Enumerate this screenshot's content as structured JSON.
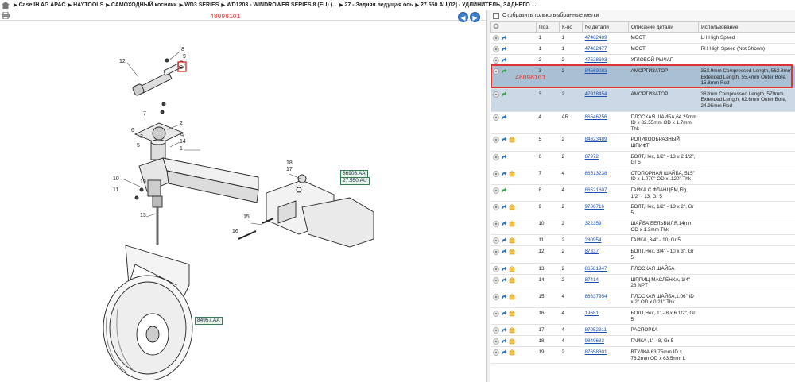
{
  "breadcrumb": [
    "Case IH AG APAC",
    "HAYTOOLS",
    "САМОХОДНЫЙ косилки",
    "WD3 SERIES",
    "WD1203 - WINDROWER SERIES 8 (EU) (...",
    "27 - Задняя ведущая ось",
    "27.550.AU[02] - УДЛИНИТЕЛЬ, ЗАДНЕГО ..."
  ],
  "diagram": {
    "id_label": "48098101",
    "callouts": [
      "86908.AA",
      "27.550.AU",
      "84957.AA"
    ],
    "part_labels": [
      "8",
      "9",
      "12",
      "8",
      "7",
      "2",
      "6",
      "3",
      "9",
      "14",
      "5",
      "1",
      "18",
      "17",
      "10",
      "19",
      "11",
      "13",
      "15",
      "16"
    ]
  },
  "filter": {
    "label": "Отобразить только выбранные метки"
  },
  "table": {
    "headers": [
      "Поз.",
      "К-во",
      "№ детали",
      "Описание детали",
      "Использование"
    ],
    "rows": [
      {
        "pos": "1",
        "qty": "1",
        "part": "47462489",
        "desc": "МОСТ",
        "use": "LH High Speed"
      },
      {
        "pos": "1",
        "qty": "1",
        "part": "47462477",
        "desc": "МОСТ",
        "use": "RH High Speed (Not Shown)"
      },
      {
        "pos": "2",
        "qty": "2",
        "part": "47528603",
        "desc": "УГЛОВОЙ РЫЧАГ",
        "use": ""
      },
      {
        "pos": "3",
        "qty": "2",
        "part": "84569083",
        "desc": "АМОРТИЗАТОР",
        "use": "353.9mm Compressed Length, 563.8mm Extended Length, 55.4mm Outer Bore, 15.8mm Rod"
      },
      {
        "pos": "3",
        "qty": "2",
        "part": "47918454",
        "desc": "АМОРТИЗАТОР",
        "use": "362mm Compressed Length, 579mm Extended Length, 62.6mm Outer Bore, 24.95mm Rod"
      },
      {
        "pos": "4",
        "qty": "AR",
        "part": "86546256",
        "desc": "ПЛОСКАЯ ШАЙБА,64.29mm ID x 82.55mm OD x 1.7mm Thk",
        "use": ""
      },
      {
        "pos": "5",
        "qty": "2",
        "part": "84323489",
        "desc": "РОЛИКООБРАЗНЫЙ ШПИФТ",
        "use": ""
      },
      {
        "pos": "6",
        "qty": "2",
        "part": "87972",
        "desc": "БОЛТ,Hex, 1/2\" - 13 x 2 1/2\", Gr 5",
        "use": ""
      },
      {
        "pos": "7",
        "qty": "4",
        "part": "86513238",
        "desc": "СТОПОРНАЯ ШАЙБА, 515\" ID x 1.070\" OD x .120\" Thk",
        "use": ""
      },
      {
        "pos": "8",
        "qty": "4",
        "part": "86521607",
        "desc": "ГАЙКА С ФЛАНЦЕМ,Flg, 1/2\" - 13, Gr 5",
        "use": ""
      },
      {
        "pos": "9",
        "qty": "2",
        "part": "9706716",
        "desc": "БОЛТ,Hex, 1/2\" - 13 x 2\", Gr 5",
        "use": ""
      },
      {
        "pos": "10",
        "qty": "2",
        "part": "322359",
        "desc": "ШАЙБА БЕЛЬВИЛЯ,14mm OD x 1.3mm Thk",
        "use": ""
      },
      {
        "pos": "11",
        "qty": "2",
        "part": "280954",
        "desc": "ГАЙКА ,3/4\" - 10, Gr 5",
        "use": ""
      },
      {
        "pos": "12",
        "qty": "2",
        "part": "87337",
        "desc": "БОЛТ,Hex, 3/4\" - 10 x 3\", Gr 5",
        "use": ""
      },
      {
        "pos": "13",
        "qty": "2",
        "part": "86581947",
        "desc": "ПЛОСКАЯ ШАЙБА",
        "use": ""
      },
      {
        "pos": "14",
        "qty": "2",
        "part": "87414",
        "desc": "ШПРИЦ-МАСЛЕНКА, 1/4\" - 28 NPT",
        "use": ""
      },
      {
        "pos": "15",
        "qty": "4",
        "part": "86637954",
        "desc": "ПЛОСКАЯ ШАЙБА,1.06\" ID x 2\" OD x 0.21\" Thk",
        "use": ""
      },
      {
        "pos": "16",
        "qty": "4",
        "part": "19681",
        "desc": "БОЛТ,Hex, 1\" - 8 x 6 1/2\", Gr 5",
        "use": ""
      },
      {
        "pos": "17",
        "qty": "4",
        "part": "87052311",
        "desc": "РАСПОРКА",
        "use": ""
      },
      {
        "pos": "18",
        "qty": "4",
        "part": "9849633",
        "desc": "ГАЙКА ,1\" - 8, Gr 5",
        "use": ""
      },
      {
        "pos": "19",
        "qty": "2",
        "part": "87658301",
        "desc": "ВТУЛКА,63.75mm ID x 76.2mm OD x 63.5mm L",
        "use": ""
      }
    ]
  },
  "selection_label": "48098101"
}
